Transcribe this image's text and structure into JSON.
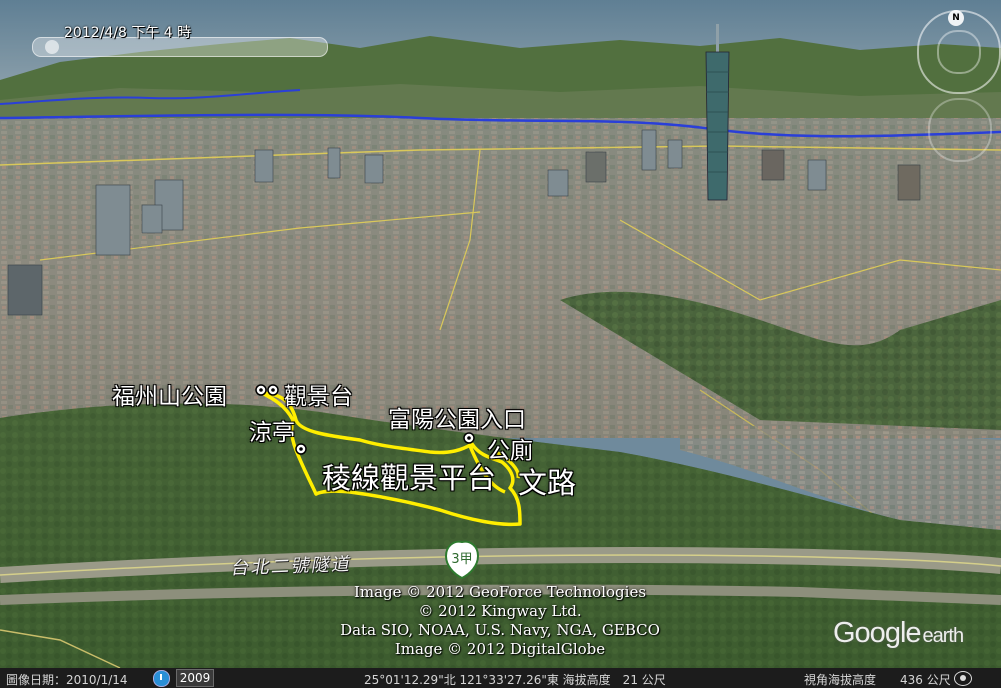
{
  "time_control": {
    "label": "2012/4/8 下午 4 時"
  },
  "navigation": {
    "north_label": "N"
  },
  "place_labels": {
    "fuzhou_park": "福州山公園",
    "viewing_deck": "觀景台",
    "pavilion": "涼亭",
    "ridge_viewpoint": "稜線觀景平台",
    "fuyang_entrance": "富陽公園入口",
    "restroom": "公廁",
    "wen_road": "文路"
  },
  "road": {
    "label": "台北二號隧道",
    "shield": "3甲"
  },
  "copyright": {
    "line1": "Image © 2012 GeoForce Technologies",
    "line2": "© 2012 Kingway Ltd.",
    "line3": "Data SIO, NOAA, U.S. Navy, NGA, GEBCO",
    "line4": "Image © 2012 DigitalGlobe"
  },
  "logo": {
    "main": "Google",
    "sub": "earth"
  },
  "status_bar": {
    "imagery_date": "圖像日期：2010/1/14",
    "year": "2009",
    "coordinates": "25°01'12.29\"北 121°33'27.26\"東 海拔高度　21 公尺",
    "eye_altitude": "視角海拔高度　　436 公尺"
  },
  "colors": {
    "track": "#ffee00",
    "river": "#2a3fd8",
    "status_bg": "#1c1c1c"
  }
}
